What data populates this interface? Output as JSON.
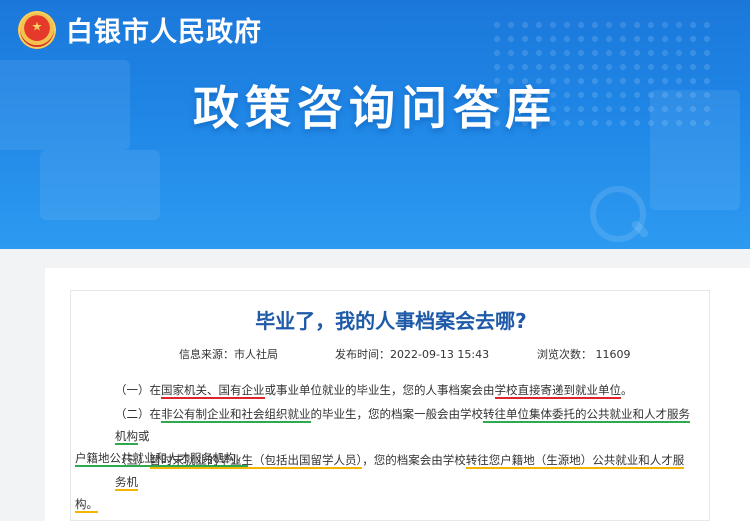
{
  "header": {
    "site_name": "白银市人民政府",
    "banner_title": "政策咨询问答库"
  },
  "article": {
    "title": "毕业了，我的人事档案会去哪?",
    "source": "信息来源：市人社局",
    "publish_time": "发布时间：2022-09-13 15:43",
    "views": "浏览次数：  11609",
    "p1": {
      "a": "（一）在",
      "b": "国家机关、国有企业",
      "c": "或事业单位就业的毕业生，您的人事档案会由",
      "d": "学校直接寄递到就业单位",
      "e": "。"
    },
    "p2": {
      "a": "（二）在",
      "b": "非公有制企业和社会组织就业",
      "c": "的毕业生，您的档案一般会由学校",
      "d": "转往单位集体委托的公共就业和人才服务机构",
      "e": "或",
      "f": "户籍地公共就业和人才服务机构。"
    },
    "p3": {
      "a": "（三）",
      "b": "暂时未就业的毕业生（包括出国留学人员）",
      "c": "，您的档案会由学校",
      "d": "转往您户籍地（生源地）公共就业和人才服务机",
      "e": "构。"
    }
  },
  "colors": {
    "banner": "#1f86e6",
    "title": "#1e5aa8",
    "underline_red": "#e0242b",
    "underline_green": "#2fa84f",
    "underline_yellow": "#f4b400"
  }
}
